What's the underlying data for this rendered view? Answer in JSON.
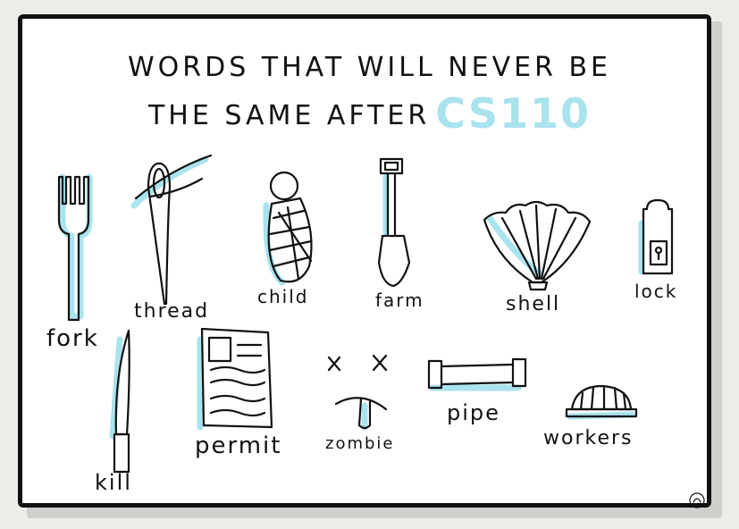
{
  "title": {
    "line1": "WORDS THAT WILL NEVER BE",
    "line2": "THE SAME AFTER",
    "highlight": "CS110"
  },
  "colors": {
    "accent": "#a9e3ee",
    "ink": "#111111",
    "paper": "#ffffff"
  },
  "items": [
    {
      "label": "fork",
      "icon": "fork-icon"
    },
    {
      "label": "thread",
      "icon": "needle-thread-icon"
    },
    {
      "label": "child",
      "icon": "swaddled-baby-icon"
    },
    {
      "label": "farm",
      "icon": "shovel-icon"
    },
    {
      "label": "shell",
      "icon": "seashell-icon"
    },
    {
      "label": "lock",
      "icon": "door-hanger-lock-icon"
    },
    {
      "label": "kill",
      "icon": "knife-icon"
    },
    {
      "label": "permit",
      "icon": "document-icon"
    },
    {
      "label": "zombie",
      "icon": "zombie-face-icon"
    },
    {
      "label": "pipe",
      "icon": "pipe-icon"
    },
    {
      "label": "workers",
      "icon": "hard-hat-icon"
    }
  ]
}
